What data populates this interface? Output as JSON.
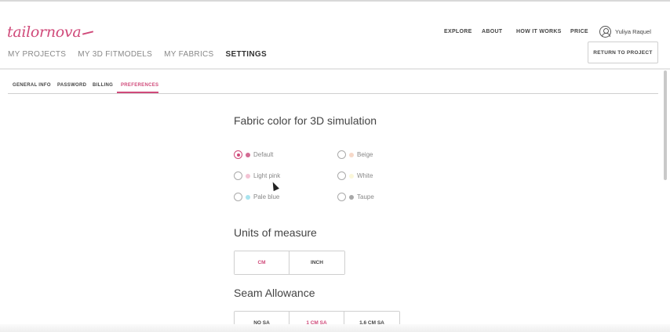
{
  "header": {
    "logo": "tailornova",
    "top_nav": [
      "EXPLORE",
      "ABOUT",
      "HOW IT WORKS",
      "PRICE"
    ],
    "user_name": "Yuliya Raquel",
    "main_nav": [
      {
        "label": "MY PROJECTS",
        "active": false
      },
      {
        "label": "MY 3D FITMODELS",
        "active": false
      },
      {
        "label": "MY FABRICS",
        "active": false
      },
      {
        "label": "SETTINGS",
        "active": true
      }
    ],
    "return_button": "RETURN TO PROJECT"
  },
  "subtabs": [
    {
      "label": "GENERAL INFO",
      "active": false
    },
    {
      "label": "PASSWORD",
      "active": false
    },
    {
      "label": "BILLING",
      "active": false
    },
    {
      "label": "PREFERENCES",
      "active": true
    }
  ],
  "fabric_color": {
    "title": "Fabric color for 3D simulation",
    "options": [
      {
        "label": "Default",
        "color": "#d36b93",
        "checked": true
      },
      {
        "label": "Light pink",
        "color": "#f3c3d4",
        "checked": false
      },
      {
        "label": "Pale blue",
        "color": "#a9e4ef",
        "checked": false
      },
      {
        "label": "Beige",
        "color": "#f6d8c8",
        "checked": false
      },
      {
        "label": "White",
        "color": "#fbf7d9",
        "checked": false
      },
      {
        "label": "Taupe",
        "color": "#a8a8a8",
        "checked": false
      }
    ]
  },
  "units": {
    "title": "Units of measure",
    "options": [
      {
        "label": "CM",
        "selected": true
      },
      {
        "label": "INCH",
        "selected": false
      }
    ]
  },
  "seam_allowance": {
    "title": "Seam Allowance",
    "options": [
      {
        "label": "NO SA",
        "selected": false
      },
      {
        "label": "1 CM SA",
        "selected": true
      },
      {
        "label": "1.6 CM SA",
        "selected": false
      }
    ]
  },
  "colors": {
    "accent": "#d04a7a"
  }
}
